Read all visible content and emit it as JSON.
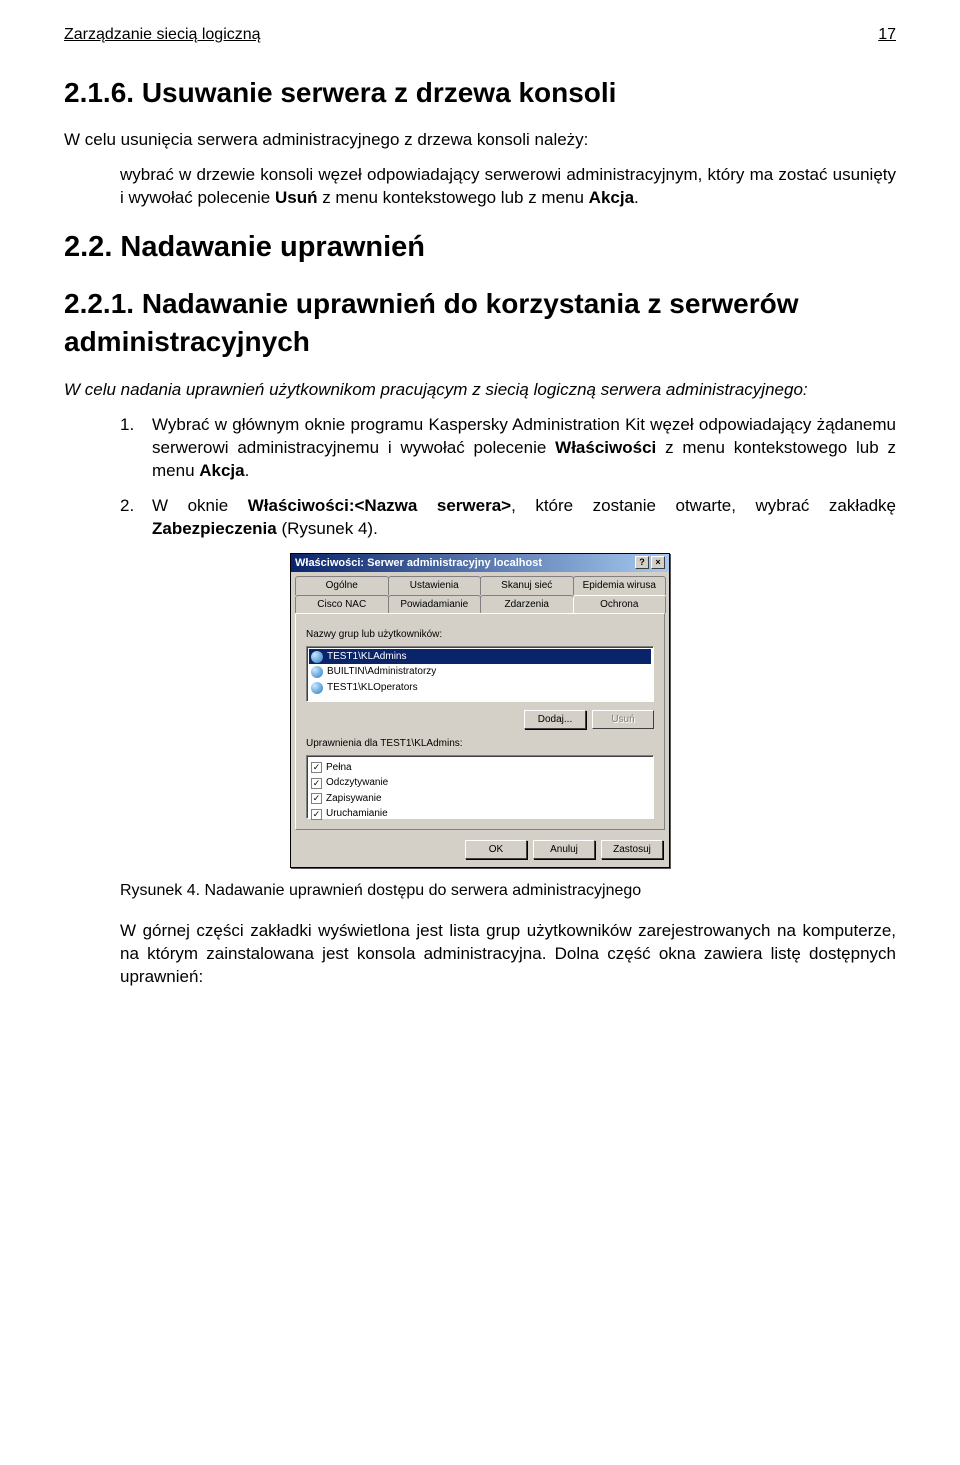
{
  "header": {
    "left": "Zarządzanie siecią logiczną",
    "right": "17"
  },
  "s1": {
    "heading": "2.1.6. Usuwanie serwera z drzewa konsoli",
    "intro": "W celu usunięcia serwera administracyjnego z drzewa konsoli należy:",
    "body": "wybrać w drzewie konsoli węzeł odpowiadający serwerowi administracyjnym, który ma zostać usunięty i wywołać polecenie Usuń z menu kontekstowego lub z menu Akcja."
  },
  "s2": {
    "heading": "2.2. Nadawanie uprawnień"
  },
  "s3": {
    "heading": "2.2.1. Nadawanie uprawnień do korzystania z serwerów administracyjnych",
    "intro": "W celu nadania uprawnień użytkownikom pracującym z siecią logiczną serwera administracyjnego:",
    "li1": "Wybrać w głównym oknie programu Kaspersky Administration Kit węzeł odpowiadający żądanemu serwerowi administracyjnemu i wywołać polecenie Właściwości z menu kontekstowego lub z menu Akcja.",
    "li2": "W oknie Właściwości:<Nazwa serwera>, które zostanie otwarte, wybrać zakładkę Zabezpieczenia (Rysunek 4)."
  },
  "dialog": {
    "title": "Właściwości: Serwer administracyjny localhost",
    "tabs_row1": [
      "Ogólne",
      "Ustawienia",
      "Skanuj sieć",
      "Epidemia wirusa"
    ],
    "tabs_row2": [
      "Cisco NAC",
      "Powiadamianie",
      "Zdarzenia",
      "Ochrona"
    ],
    "groups_label": "Nazwy grup lub użytkowników:",
    "groups": [
      "TEST1\\KLAdmins",
      "BUILTIN\\Administratorzy",
      "TEST1\\KLOperators"
    ],
    "btn_add": "Dodaj...",
    "btn_remove": "Usuń",
    "perm_label": "Uprawnienia dla TEST1\\KLAdmins:",
    "perms": [
      "Pełna",
      "Odczytywanie",
      "Zapisywanie",
      "Uruchamianie"
    ],
    "btn_ok": "OK",
    "btn_cancel": "Anuluj",
    "btn_apply": "Zastosuj"
  },
  "caption": "Rysunek 4. Nadawanie uprawnień dostępu do serwera administracyjnego",
  "bottom": "W górnej części zakładki wyświetlona jest lista grup użytkowników zarejestrowanych na komputerze, na którym zainstalowana jest konsola administracyjna. Dolna część okna zawiera listę dostępnych uprawnień:"
}
